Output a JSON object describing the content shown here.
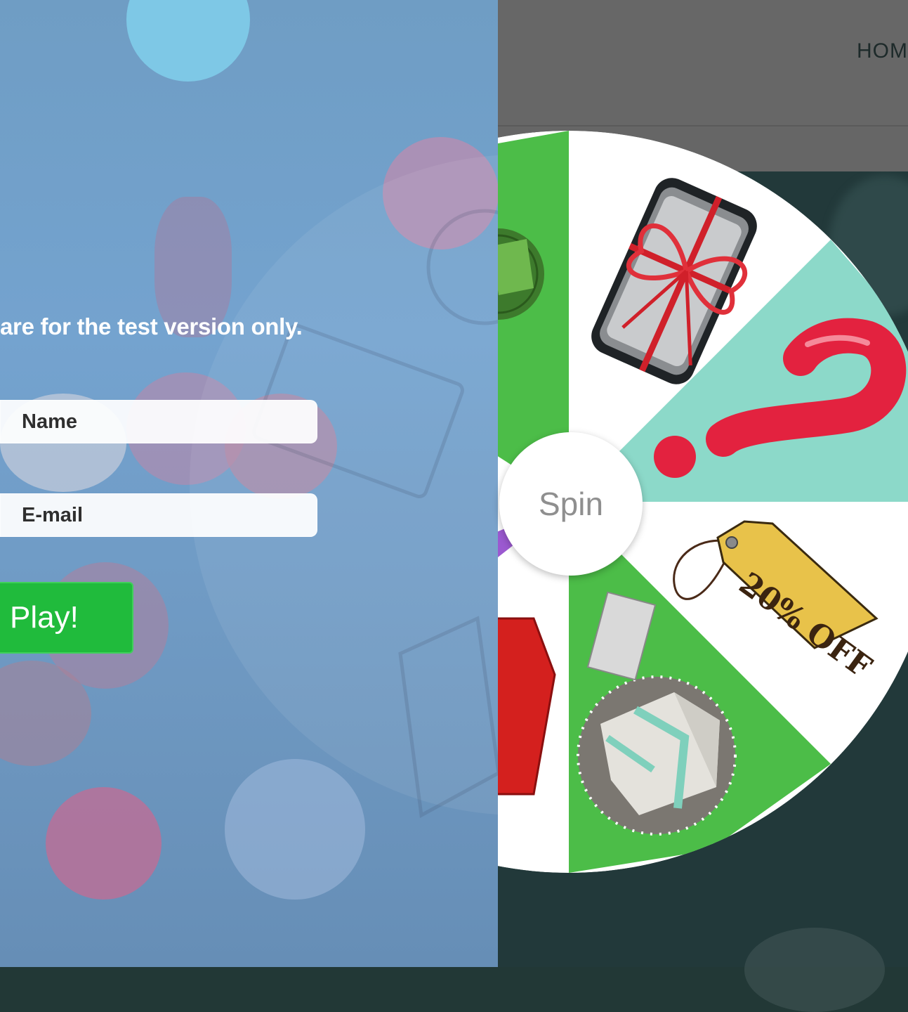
{
  "header": {
    "nav_home": "HOME"
  },
  "form": {
    "disclaimer": "are for the test version only.",
    "name_placeholder": "Name",
    "email_placeholder": "E-mail",
    "play_label": "Play!"
  },
  "wheel": {
    "spin_label": "Spin",
    "tag_text": "20% OFF",
    "segments": [
      {
        "prize": "discount-badge-icon",
        "color": "#4cbd48"
      },
      {
        "prize": "gift-phone-icon",
        "color": "#ffffff"
      },
      {
        "prize": "question-mark-icon",
        "color": "#8cd9c9"
      },
      {
        "prize": "price-tag-icon",
        "color": "#ffffff"
      },
      {
        "prize": "secret-gift-box-icon",
        "color": "#4cbd48"
      },
      {
        "prize": "sale-sign-icon",
        "color": "#ffffff"
      }
    ]
  },
  "colors": {
    "play_button": "#20bb3c",
    "wheel_green": "#4cbd48",
    "wheel_teal": "#8cd9c9",
    "question_red": "#e3223f"
  }
}
